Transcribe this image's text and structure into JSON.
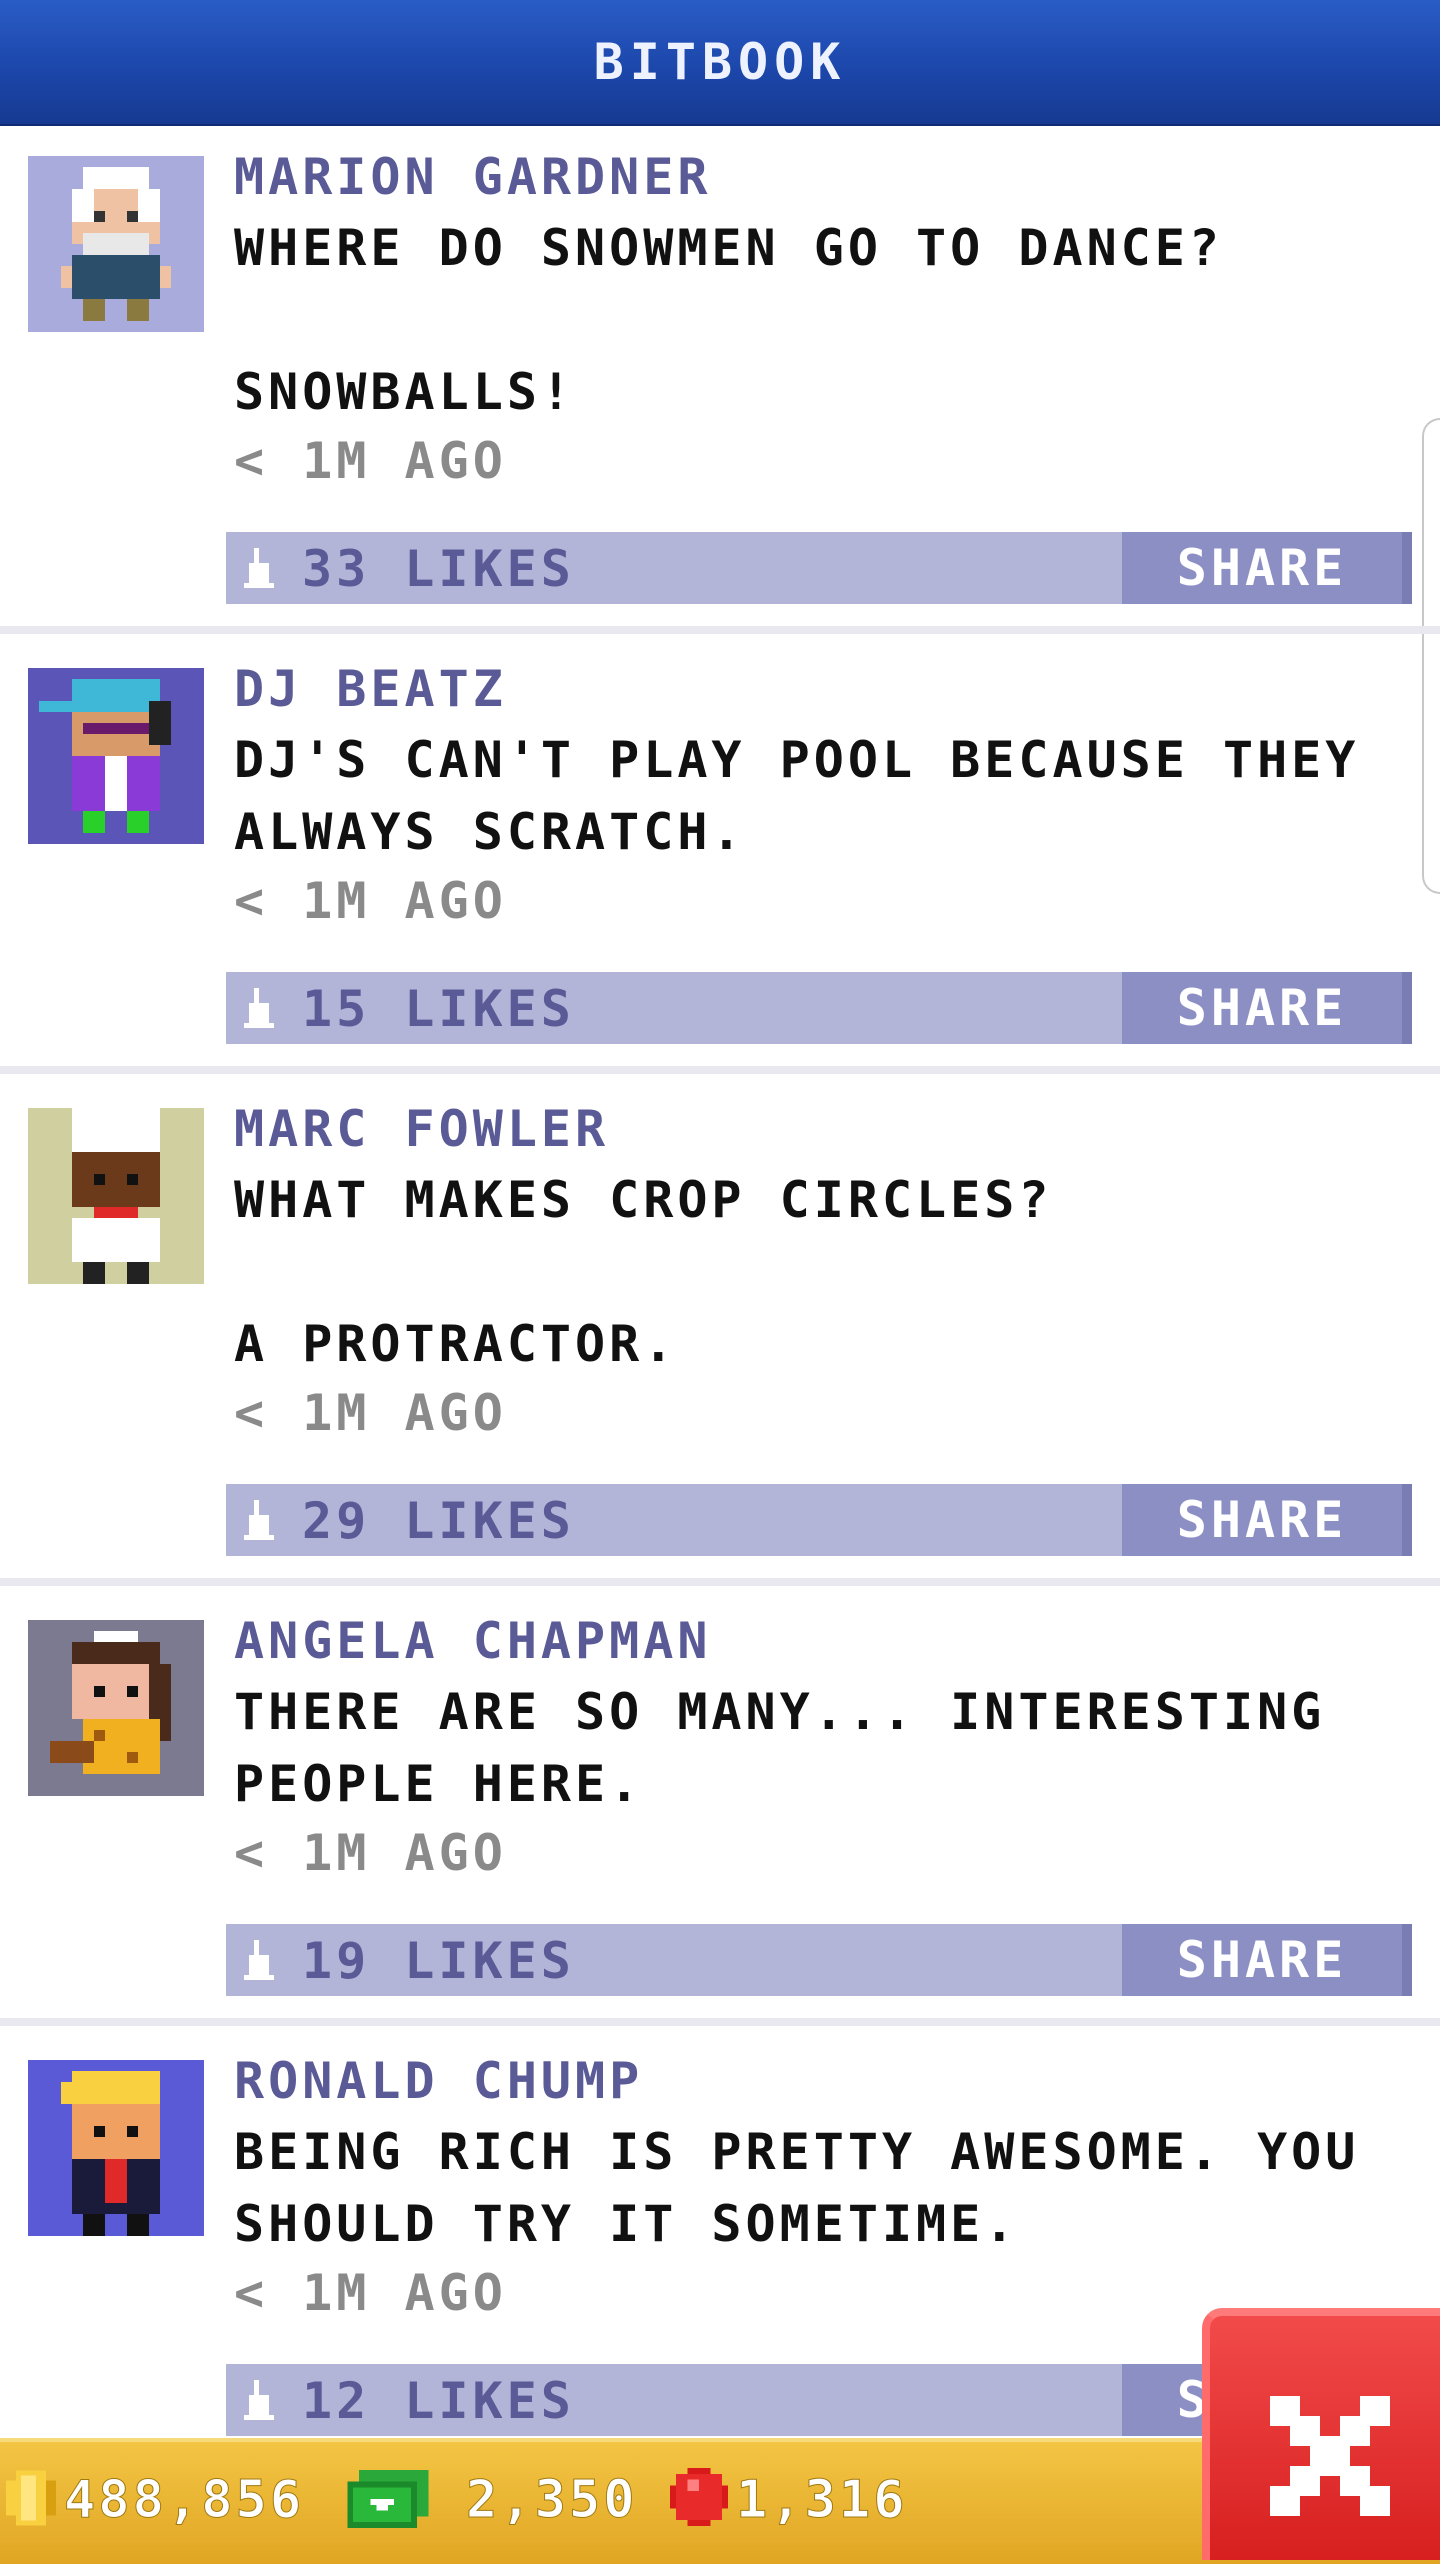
{
  "header": {
    "title": "BITBOOK"
  },
  "posts": [
    {
      "name": "MARION GARDNER",
      "message": "WHERE DO SNOWMEN GO TO DANCE?\n\nSNOWBALLS!",
      "time": "< 1M AGO",
      "likes": "33 LIKES",
      "share": "SHARE",
      "avatar_bg": "#a9abdc"
    },
    {
      "name": "DJ BEATZ",
      "message": "DJ'S CAN'T PLAY POOL BECAUSE THEY ALWAYS SCRATCH.",
      "time": "< 1M AGO",
      "likes": "15 LIKES",
      "share": "SHARE",
      "avatar_bg": "#5b55b8"
    },
    {
      "name": "MARC FOWLER",
      "message": "WHAT MAKES CROP CIRCLES?\n\nA PROTRACTOR.",
      "time": "< 1M AGO",
      "likes": "29 LIKES",
      "share": "SHARE",
      "avatar_bg": "#cfcfa0"
    },
    {
      "name": "ANGELA CHAPMAN",
      "message": "THERE ARE SO MANY... INTERESTING PEOPLE HERE.",
      "time": "< 1M AGO",
      "likes": "19 LIKES",
      "share": "SHARE",
      "avatar_bg": "#7c7a90"
    },
    {
      "name": "RONALD CHUMP",
      "message": "BEING RICH IS PRETTY AWESOME. YOU SHOULD TRY IT SOMETIME.",
      "time": "< 1M AGO",
      "likes": "12 LIKES",
      "share": "SHARE",
      "avatar_bg": "#5a5ad6"
    }
  ],
  "footer": {
    "coins": "488,856",
    "bux": "2,350",
    "gems": "1,316"
  },
  "icons": {
    "like": "thumbs-up-icon",
    "coin": "coin-icon",
    "bux": "bux-icon",
    "gem": "gem-icon",
    "close": "close-icon"
  },
  "colors": {
    "header": "#1b45a8",
    "like_bar": "#b3b5d8",
    "share_button": "#8c8fc4",
    "footer": "#e8b12e",
    "close_button": "#e02a2a"
  }
}
